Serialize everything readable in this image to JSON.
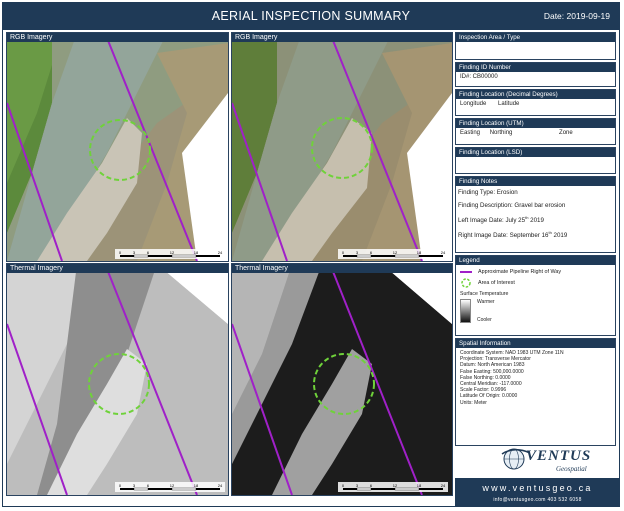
{
  "header": {
    "title": "AERIAL INSPECTION SUMMARY",
    "date": "Date: 2019-09-19"
  },
  "panels": {
    "rgb_left": {
      "label": "RGB Imagery"
    },
    "rgb_right": {
      "label": "RGB Imagery"
    },
    "thermal_left": {
      "label": "Thermal Imagery"
    },
    "thermal_right": {
      "label": "Thermal Imagery"
    }
  },
  "scale_labels": [
    "0",
    "3",
    "6",
    "12",
    "18",
    "24"
  ],
  "sections": {
    "inspection_area": {
      "title": "Inspection Area / Type"
    },
    "finding_id": {
      "title": "Finding ID Number",
      "value": "ID#: CB00000"
    },
    "location_decimal": {
      "title": "Finding Location (Decimal Degrees)",
      "longitude": "Longitude",
      "latitude": "Latitude"
    },
    "location_utm": {
      "title": "Finding Location (UTM)",
      "easting": "Easting",
      "northing": "Northing",
      "zone": "Zone"
    },
    "location_lsd": {
      "title": "Finding Location (LSD)"
    },
    "notes": {
      "title": "Finding Notes",
      "type": "Finding Type: Erosion",
      "description": "Finding Description: Gravel bar erosion",
      "left_date": "Left Image Date: July 25",
      "left_date_sup": "th",
      "left_date_year": " 2019",
      "right_date": "Right Image Date: September 16",
      "right_date_sup": "th",
      "right_date_year": " 2019"
    },
    "legend": {
      "title": "Legend",
      "pipeline": "Approximate Pipeline Right of Way",
      "area": "Area of Interest",
      "surface_temp": "Surface Temperature",
      "warmer": "Warmer",
      "cooler": "Cooler"
    },
    "spatial": {
      "title": "Spatial Information",
      "lines": [
        "Coordinate System: NAD 1983 UTM Zone 11N",
        "Projection: Transverse Mercator",
        "Datum: North American 1983",
        "False Easting: 500,000.0000",
        "False Northing: 0.0000",
        "Central Meridian: -117.0000",
        "Scale Factor: 0.9996",
        "Latitude Of Origin: 0.0000",
        "Units: Meter"
      ]
    }
  },
  "footer": {
    "brand": "VENTUS",
    "brand_sub": "Geospatial",
    "website": "www.ventusgeo.ca",
    "contact": "info@ventusgeo.com   403 532 6058"
  },
  "colors": {
    "header": "#1f3a57",
    "pipeline": "#a020c8",
    "area_of_interest": "#6fd23a"
  }
}
